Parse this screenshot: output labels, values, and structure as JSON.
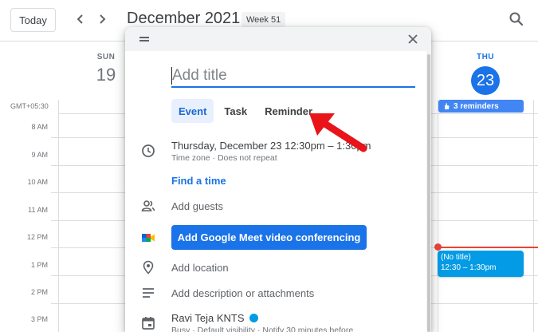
{
  "header": {
    "today_label": "Today",
    "month_title": "December 2021",
    "week_badge": "Week 51"
  },
  "calendar": {
    "days": [
      {
        "name": "SUN",
        "number": "19"
      },
      {
        "name": "THU",
        "number": "23"
      }
    ],
    "timezone": "GMT+05:30",
    "hours": [
      "8 AM",
      "9 AM",
      "10 AM",
      "11 AM",
      "12 PM",
      "1 PM",
      "2 PM",
      "3 PM"
    ],
    "reminders_chip": "3 reminders",
    "event": {
      "title": "(No title)",
      "time": "12:30 – 1:30pm"
    }
  },
  "dialog": {
    "title_placeholder": "Add title",
    "tabs": [
      {
        "label": "Event",
        "active": true
      },
      {
        "label": "Task",
        "active": false
      },
      {
        "label": "Reminder",
        "active": false
      }
    ],
    "date_line": "Thursday, December 23    12:30pm  –  1:30pm",
    "date_sub": "Time zone · Does not repeat",
    "find_time": "Find a time",
    "add_guests": "Add guests",
    "meet_button": "Add Google Meet video conferencing",
    "add_location": "Add location",
    "add_description": "Add description or attachments",
    "owner_name": "Ravi Teja KNTS",
    "owner_sub": "Busy · Default visibility · Notify 30 minutes before"
  },
  "colors": {
    "accent": "#1a73e8",
    "event": "#039be5",
    "reminder_chip": "#4285f4",
    "now_line": "#ea4335",
    "annotation_arrow": "#e8141a"
  }
}
